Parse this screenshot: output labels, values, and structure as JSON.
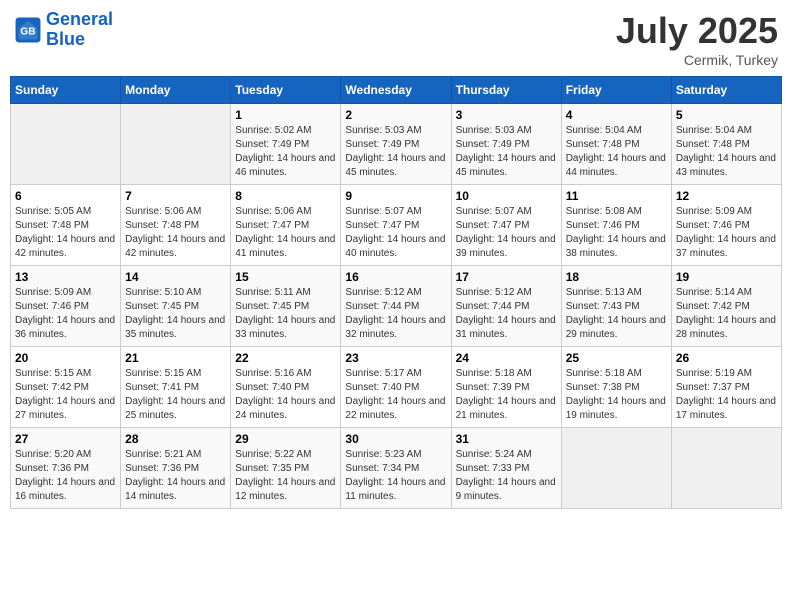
{
  "header": {
    "logo_line1": "General",
    "logo_line2": "Blue",
    "month": "July 2025",
    "location": "Cermik, Turkey"
  },
  "weekdays": [
    "Sunday",
    "Monday",
    "Tuesday",
    "Wednesday",
    "Thursday",
    "Friday",
    "Saturday"
  ],
  "weeks": [
    [
      {
        "day": "",
        "empty": true
      },
      {
        "day": "",
        "empty": true
      },
      {
        "day": "1",
        "sunrise": "5:02 AM",
        "sunset": "7:49 PM",
        "daylight": "14 hours and 46 minutes."
      },
      {
        "day": "2",
        "sunrise": "5:03 AM",
        "sunset": "7:49 PM",
        "daylight": "14 hours and 45 minutes."
      },
      {
        "day": "3",
        "sunrise": "5:03 AM",
        "sunset": "7:49 PM",
        "daylight": "14 hours and 45 minutes."
      },
      {
        "day": "4",
        "sunrise": "5:04 AM",
        "sunset": "7:48 PM",
        "daylight": "14 hours and 44 minutes."
      },
      {
        "day": "5",
        "sunrise": "5:04 AM",
        "sunset": "7:48 PM",
        "daylight": "14 hours and 43 minutes."
      }
    ],
    [
      {
        "day": "6",
        "sunrise": "5:05 AM",
        "sunset": "7:48 PM",
        "daylight": "14 hours and 42 minutes."
      },
      {
        "day": "7",
        "sunrise": "5:06 AM",
        "sunset": "7:48 PM",
        "daylight": "14 hours and 42 minutes."
      },
      {
        "day": "8",
        "sunrise": "5:06 AM",
        "sunset": "7:47 PM",
        "daylight": "14 hours and 41 minutes."
      },
      {
        "day": "9",
        "sunrise": "5:07 AM",
        "sunset": "7:47 PM",
        "daylight": "14 hours and 40 minutes."
      },
      {
        "day": "10",
        "sunrise": "5:07 AM",
        "sunset": "7:47 PM",
        "daylight": "14 hours and 39 minutes."
      },
      {
        "day": "11",
        "sunrise": "5:08 AM",
        "sunset": "7:46 PM",
        "daylight": "14 hours and 38 minutes."
      },
      {
        "day": "12",
        "sunrise": "5:09 AM",
        "sunset": "7:46 PM",
        "daylight": "14 hours and 37 minutes."
      }
    ],
    [
      {
        "day": "13",
        "sunrise": "5:09 AM",
        "sunset": "7:46 PM",
        "daylight": "14 hours and 36 minutes."
      },
      {
        "day": "14",
        "sunrise": "5:10 AM",
        "sunset": "7:45 PM",
        "daylight": "14 hours and 35 minutes."
      },
      {
        "day": "15",
        "sunrise": "5:11 AM",
        "sunset": "7:45 PM",
        "daylight": "14 hours and 33 minutes."
      },
      {
        "day": "16",
        "sunrise": "5:12 AM",
        "sunset": "7:44 PM",
        "daylight": "14 hours and 32 minutes."
      },
      {
        "day": "17",
        "sunrise": "5:12 AM",
        "sunset": "7:44 PM",
        "daylight": "14 hours and 31 minutes."
      },
      {
        "day": "18",
        "sunrise": "5:13 AM",
        "sunset": "7:43 PM",
        "daylight": "14 hours and 29 minutes."
      },
      {
        "day": "19",
        "sunrise": "5:14 AM",
        "sunset": "7:42 PM",
        "daylight": "14 hours and 28 minutes."
      }
    ],
    [
      {
        "day": "20",
        "sunrise": "5:15 AM",
        "sunset": "7:42 PM",
        "daylight": "14 hours and 27 minutes."
      },
      {
        "day": "21",
        "sunrise": "5:15 AM",
        "sunset": "7:41 PM",
        "daylight": "14 hours and 25 minutes."
      },
      {
        "day": "22",
        "sunrise": "5:16 AM",
        "sunset": "7:40 PM",
        "daylight": "14 hours and 24 minutes."
      },
      {
        "day": "23",
        "sunrise": "5:17 AM",
        "sunset": "7:40 PM",
        "daylight": "14 hours and 22 minutes."
      },
      {
        "day": "24",
        "sunrise": "5:18 AM",
        "sunset": "7:39 PM",
        "daylight": "14 hours and 21 minutes."
      },
      {
        "day": "25",
        "sunrise": "5:18 AM",
        "sunset": "7:38 PM",
        "daylight": "14 hours and 19 minutes."
      },
      {
        "day": "26",
        "sunrise": "5:19 AM",
        "sunset": "7:37 PM",
        "daylight": "14 hours and 17 minutes."
      }
    ],
    [
      {
        "day": "27",
        "sunrise": "5:20 AM",
        "sunset": "7:36 PM",
        "daylight": "14 hours and 16 minutes."
      },
      {
        "day": "28",
        "sunrise": "5:21 AM",
        "sunset": "7:36 PM",
        "daylight": "14 hours and 14 minutes."
      },
      {
        "day": "29",
        "sunrise": "5:22 AM",
        "sunset": "7:35 PM",
        "daylight": "14 hours and 12 minutes."
      },
      {
        "day": "30",
        "sunrise": "5:23 AM",
        "sunset": "7:34 PM",
        "daylight": "14 hours and 11 minutes."
      },
      {
        "day": "31",
        "sunrise": "5:24 AM",
        "sunset": "7:33 PM",
        "daylight": "14 hours and 9 minutes."
      },
      {
        "day": "",
        "empty": true
      },
      {
        "day": "",
        "empty": true
      }
    ]
  ]
}
